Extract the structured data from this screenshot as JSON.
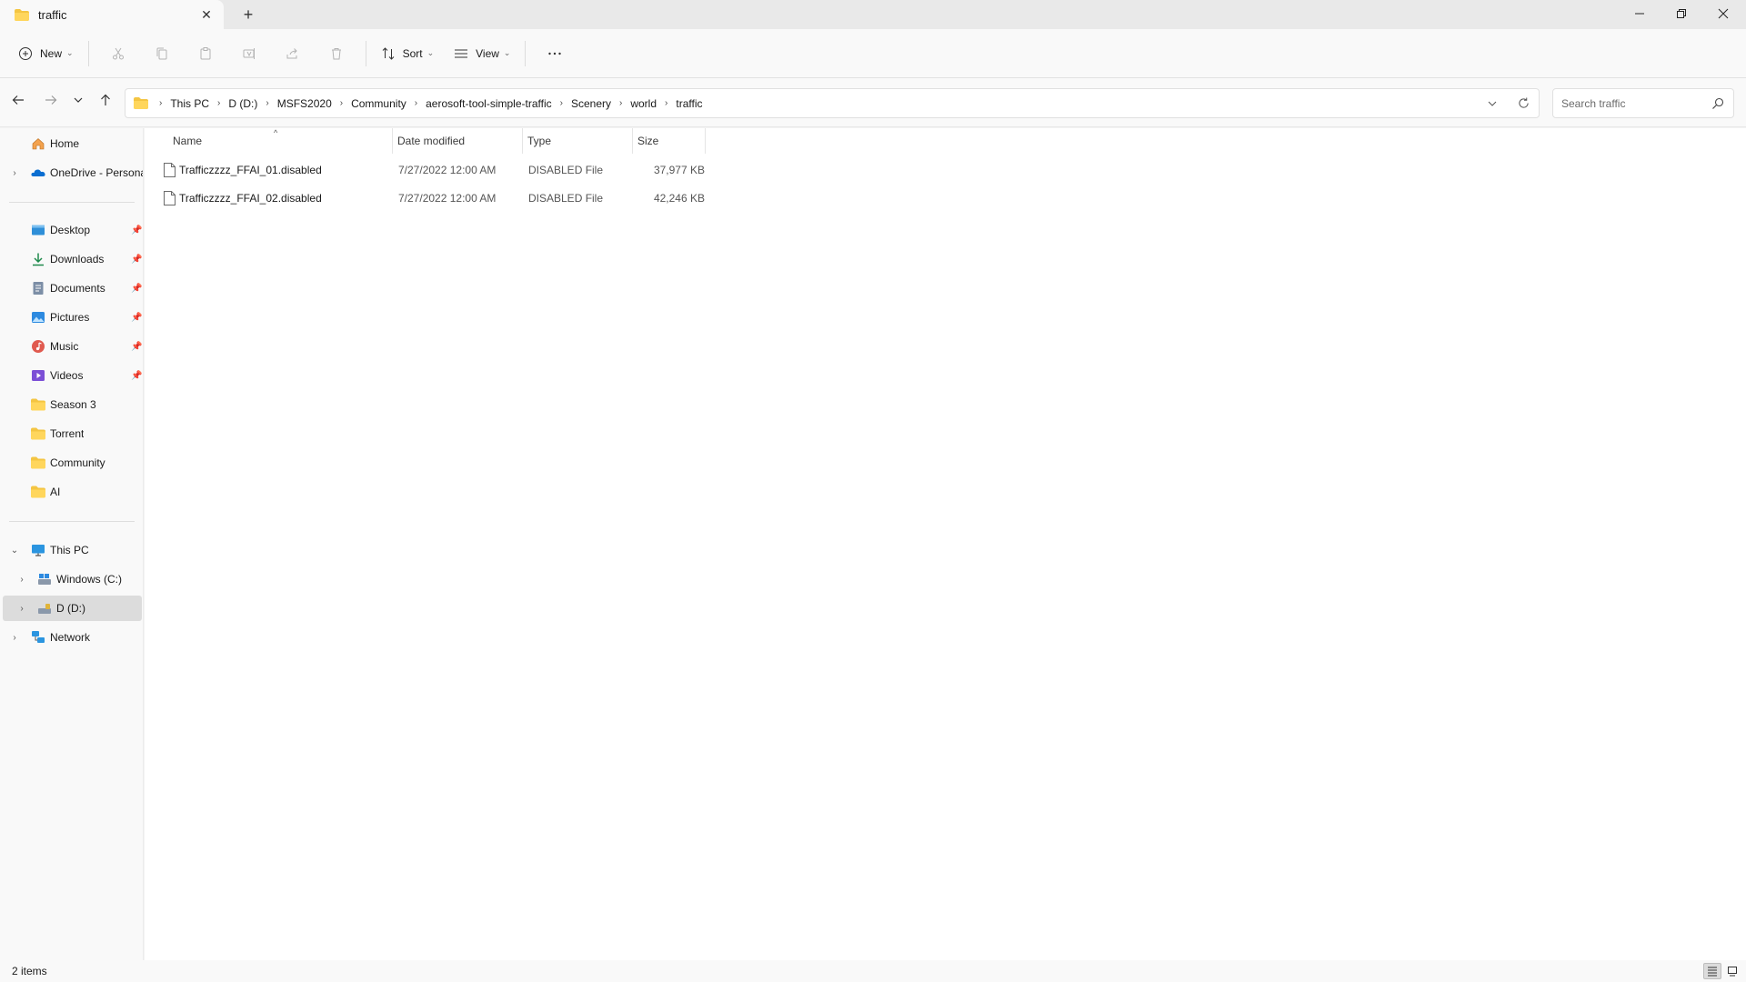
{
  "window": {
    "tab_title": "traffic",
    "new_tab_glyph": "+",
    "controls": [
      "minimize-icon",
      "restore-icon",
      "close-icon"
    ]
  },
  "toolbar": {
    "new_label": "New",
    "sort_label": "Sort",
    "view_label": "View",
    "icons": [
      "cut-icon",
      "copy-icon",
      "paste-icon",
      "rename-icon",
      "share-icon",
      "delete-icon",
      "more-icon"
    ]
  },
  "address": {
    "crumbs": [
      "This PC",
      "D (D:)",
      "MSFS2020",
      "Community",
      "aerosoft-tool-simple-traffic",
      "Scenery",
      "world",
      "traffic"
    ]
  },
  "search": {
    "placeholder": "Search traffic"
  },
  "sidebar": {
    "items": [
      {
        "label": "Home",
        "icon": "home-icon"
      },
      {
        "label": "OneDrive - Persona",
        "icon": "onedrive-icon"
      },
      {
        "label": "Desktop",
        "icon": "desktop-icon",
        "pinned": true
      },
      {
        "label": "Downloads",
        "icon": "download-icon",
        "pinned": true
      },
      {
        "label": "Documents",
        "icon": "documents-icon",
        "pinned": true
      },
      {
        "label": "Pictures",
        "icon": "pictures-icon",
        "pinned": true
      },
      {
        "label": "Music",
        "icon": "music-icon",
        "pinned": true
      },
      {
        "label": "Videos",
        "icon": "videos-icon",
        "pinned": true
      },
      {
        "label": "Season 3",
        "icon": "folder-icon"
      },
      {
        "label": "Torrent",
        "icon": "folder-icon"
      },
      {
        "label": "Community",
        "icon": "folder-icon"
      },
      {
        "label": "AI",
        "icon": "folder-icon"
      },
      {
        "label": "This PC",
        "icon": "pc-icon"
      },
      {
        "label": "Windows (C:)",
        "icon": "drive-icon"
      },
      {
        "label": "D (D:)",
        "icon": "drive-icon"
      },
      {
        "label": "Network",
        "icon": "network-icon"
      }
    ]
  },
  "columns": {
    "name": "Name",
    "date": "Date modified",
    "type": "Type",
    "size": "Size"
  },
  "files": [
    {
      "name": "Trafficzzzz_FFAI_01.disabled",
      "date": "7/27/2022 12:00 AM",
      "type": "DISABLED File",
      "size": "37,977 KB"
    },
    {
      "name": "Trafficzzzz_FFAI_02.disabled",
      "date": "7/27/2022 12:00 AM",
      "type": "DISABLED File",
      "size": "42,246 KB"
    }
  ],
  "status": {
    "count": "2 items"
  }
}
